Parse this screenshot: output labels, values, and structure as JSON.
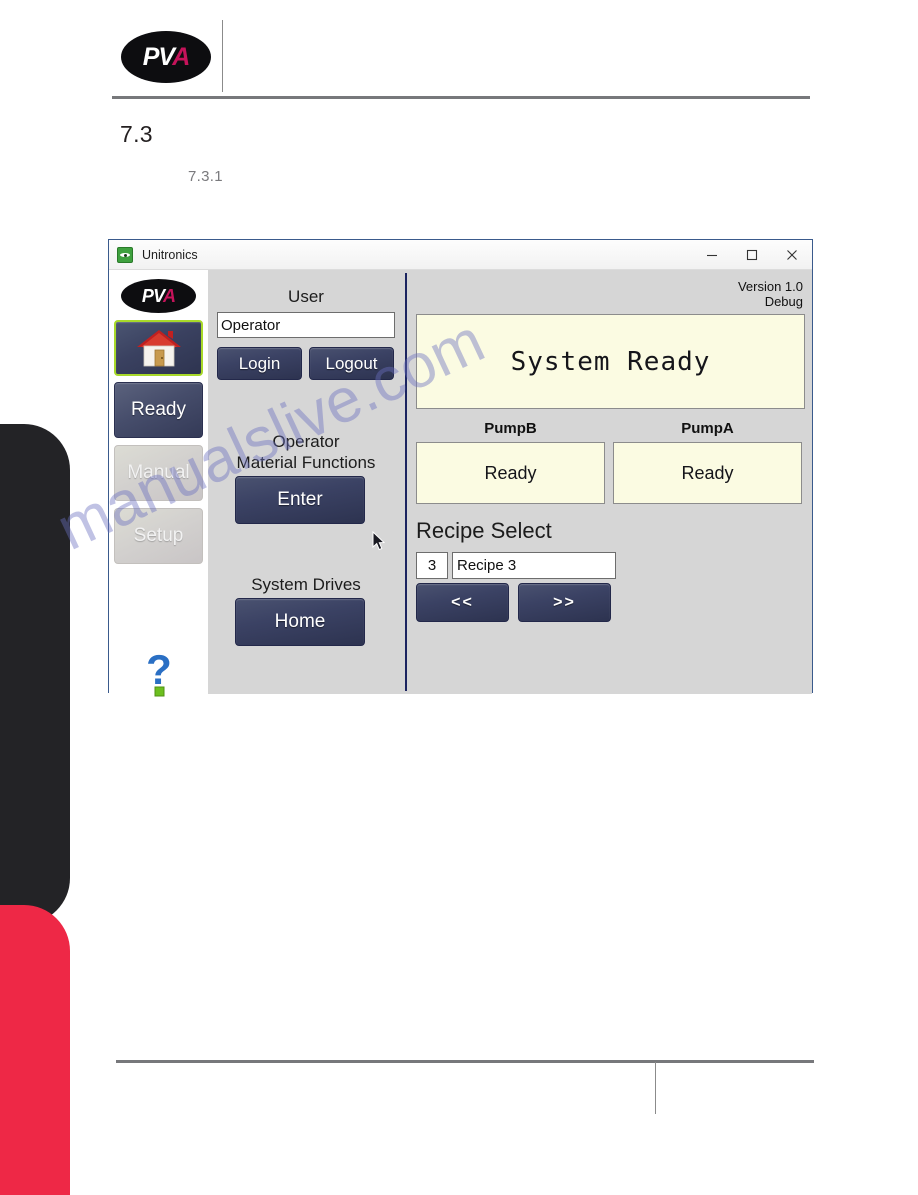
{
  "document": {
    "brand": "PVA",
    "brand_prefix": "PV",
    "brand_accent_letter": "A",
    "section_number": "7.3",
    "subsection_number": "7.3.1"
  },
  "window": {
    "title": "Unitronics",
    "icon": "unitronics-icon",
    "controls": {
      "minimize": "minimize-icon",
      "maximize": "maximize-icon",
      "close": "close-icon"
    }
  },
  "sidebar": {
    "logo": "PVA",
    "items": [
      {
        "id": "home",
        "label": "",
        "icon": "house-icon",
        "state": "selected"
      },
      {
        "id": "ready",
        "label": "Ready",
        "state": "active"
      },
      {
        "id": "manual",
        "label": "Manual",
        "state": "disabled"
      },
      {
        "id": "setup",
        "label": "Setup",
        "state": "disabled"
      }
    ],
    "help_icon": "question-mark-help-icon"
  },
  "left_panel": {
    "user_label": "User",
    "user_value": "Operator",
    "user_placeholder": "User",
    "login_label": "Login",
    "logout_label": "Logout",
    "operator_functions_line1": "Operator",
    "operator_functions_line2": "Material Functions",
    "enter_label": "Enter",
    "system_drives_label": "System Drives",
    "home_label": "Home"
  },
  "right_panel": {
    "version_line1": "Version 1.0",
    "version_line2": "Debug",
    "system_status": "System Ready",
    "pumps": [
      {
        "name": "PumpB",
        "status": "Ready"
      },
      {
        "name": "PumpA",
        "status": "Ready"
      }
    ],
    "recipe_select_label": "Recipe Select",
    "recipe_number": "3",
    "recipe_name": "Recipe 3",
    "recipe_prev_label": "<<",
    "recipe_next_label": ">>"
  },
  "watermark": {
    "text": "manualslive.com"
  },
  "colors": {
    "accent_red": "#ee2846",
    "accent_dark": "#232326",
    "button_blue": "#3b4264",
    "selection_green": "#a8d92a",
    "status_cream": "#fbfbe2",
    "panel_gray": "#d6d6d6",
    "divider_navy": "#1b2460",
    "brand_magenta": "#c5135a"
  }
}
